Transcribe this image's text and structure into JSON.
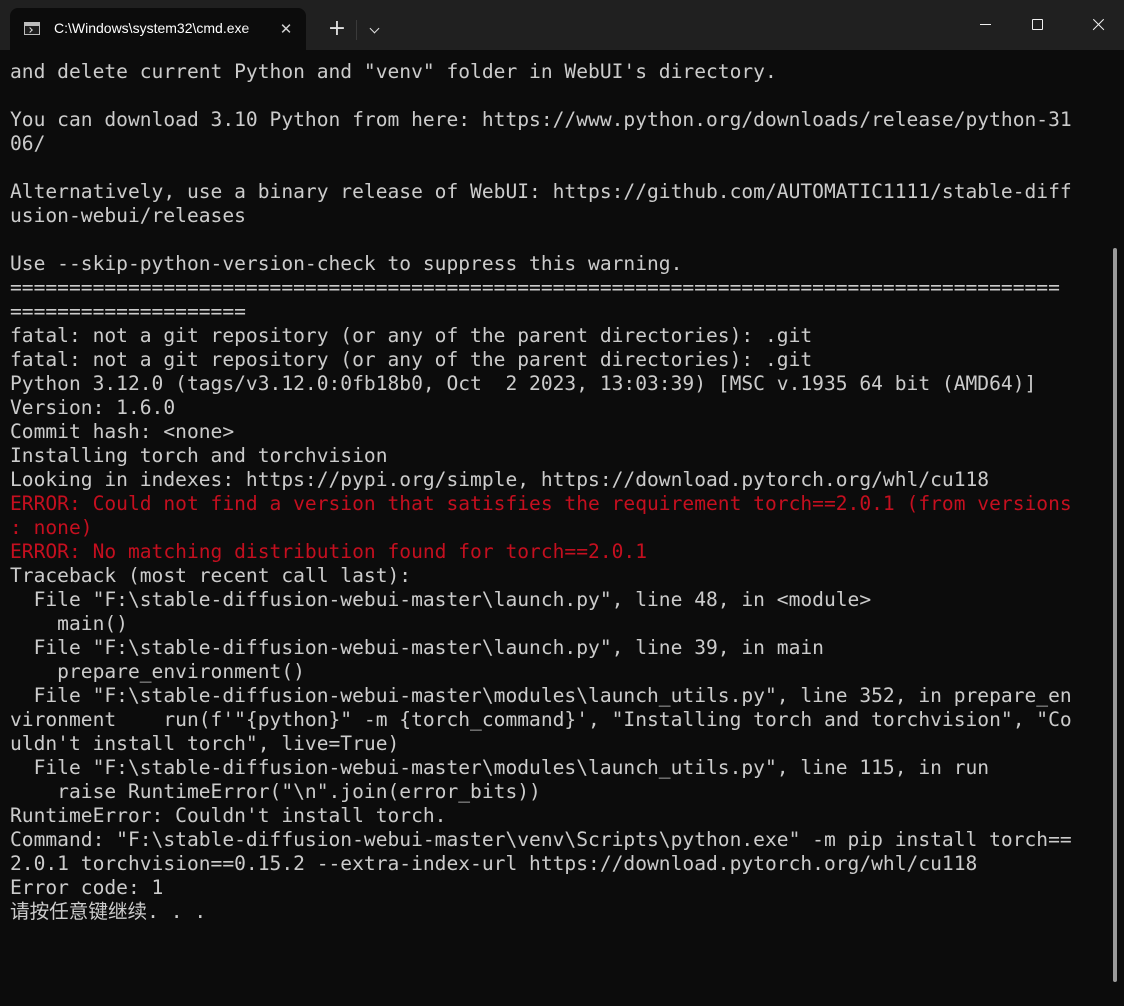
{
  "titlebar": {
    "tab_title": "C:\\Windows\\system32\\cmd.exe",
    "tab_close_glyph": "✕",
    "newtab_glyph": "+",
    "icons": [
      "cmd-terminal-icon",
      "close-icon",
      "plus-icon",
      "chevron-down-icon",
      "minimize-icon",
      "maximize-icon",
      "close-window-icon"
    ]
  },
  "terminal": {
    "foreground": "#cccccc",
    "error_color": "#c50f1f",
    "lines": [
      {
        "text": "and delete current Python and \"venv\" folder in WebUI's directory.",
        "error": false
      },
      {
        "text": "",
        "error": false
      },
      {
        "text": "You can download 3.10 Python from here: https://www.python.org/downloads/release/python-31",
        "error": false
      },
      {
        "text": "06/",
        "error": false
      },
      {
        "text": "",
        "error": false
      },
      {
        "text": "Alternatively, use a binary release of WebUI: https://github.com/AUTOMATIC1111/stable-diff",
        "error": false
      },
      {
        "text": "usion-webui/releases",
        "error": false
      },
      {
        "text": "",
        "error": false
      },
      {
        "text": "Use --skip-python-version-check to suppress this warning.",
        "error": false
      },
      {
        "text": "=========================================================================================",
        "error": false
      },
      {
        "text": "====================",
        "error": false
      },
      {
        "text": "fatal: not a git repository (or any of the parent directories): .git",
        "error": false
      },
      {
        "text": "fatal: not a git repository (or any of the parent directories): .git",
        "error": false
      },
      {
        "text": "Python 3.12.0 (tags/v3.12.0:0fb18b0, Oct  2 2023, 13:03:39) [MSC v.1935 64 bit (AMD64)]",
        "error": false
      },
      {
        "text": "Version: 1.6.0",
        "error": false
      },
      {
        "text": "Commit hash: <none>",
        "error": false
      },
      {
        "text": "Installing torch and torchvision",
        "error": false
      },
      {
        "text": "Looking in indexes: https://pypi.org/simple, https://download.pytorch.org/whl/cu118",
        "error": false
      },
      {
        "text": "ERROR: Could not find a version that satisfies the requirement torch==2.0.1 (from versions",
        "error": true
      },
      {
        "text": ": none)",
        "error": true
      },
      {
        "text": "ERROR: No matching distribution found for torch==2.0.1",
        "error": true
      },
      {
        "text": "Traceback (most recent call last):",
        "error": false
      },
      {
        "text": "  File \"F:\\stable-diffusion-webui-master\\launch.py\", line 48, in <module>",
        "error": false
      },
      {
        "text": "    main()",
        "error": false
      },
      {
        "text": "  File \"F:\\stable-diffusion-webui-master\\launch.py\", line 39, in main",
        "error": false
      },
      {
        "text": "    prepare_environment()",
        "error": false
      },
      {
        "text": "  File \"F:\\stable-diffusion-webui-master\\modules\\launch_utils.py\", line 352, in prepare_en",
        "error": false
      },
      {
        "text": "vironment    run(f'\"{python}\" -m {torch_command}', \"Installing torch and torchvision\", \"Co",
        "error": false
      },
      {
        "text": "uldn't install torch\", live=True)",
        "error": false
      },
      {
        "text": "  File \"F:\\stable-diffusion-webui-master\\modules\\launch_utils.py\", line 115, in run",
        "error": false
      },
      {
        "text": "    raise RuntimeError(\"\\n\".join(error_bits))",
        "error": false
      },
      {
        "text": "RuntimeError: Couldn't install torch.",
        "error": false
      },
      {
        "text": "Command: \"F:\\stable-diffusion-webui-master\\venv\\Scripts\\python.exe\" -m pip install torch==",
        "error": false
      },
      {
        "text": "2.0.1 torchvision==0.15.2 --extra-index-url https://download.pytorch.org/whl/cu118",
        "error": false
      },
      {
        "text": "Error code: 1",
        "error": false
      },
      {
        "text": "请按任意键继续. . .",
        "error": false
      }
    ]
  }
}
